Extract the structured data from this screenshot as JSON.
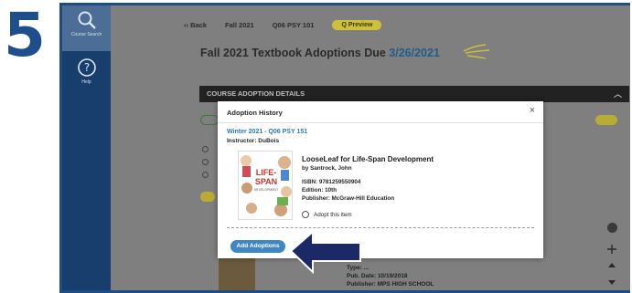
{
  "step": {
    "number": "5"
  },
  "sidebar": {
    "items": [
      {
        "label": "Course Search",
        "icon": "search-icon",
        "active": true
      },
      {
        "label": "Help",
        "icon": "help-icon",
        "active": false
      }
    ]
  },
  "topbar": {
    "back": "‹‹ Back",
    "term": "Fall 2021",
    "course": "Q06 PSY 101",
    "preview": "Q Preview"
  },
  "page": {
    "title": "Fall 2021 Textbook Adoptions Due",
    "due_date": "3/26/2021"
  },
  "section": {
    "label": "COURSE ADOPTION DETAILS",
    "toggle_icon": "chevron-up-icon"
  },
  "background": {
    "lower_type": "Type: ...",
    "pub_date": "Pub. Date: 10/19/2018",
    "publisher": "Publisher: MPS HIGH SCHOOL"
  },
  "modal": {
    "title": "Adoption History",
    "close": "×",
    "course_link": "Winter 2021 - Q06 PSY 151",
    "instructor": "Instructor: DuBois",
    "book": {
      "title": "LooseLeaf for Life-Span Development",
      "author": "by Santrock, John",
      "isbn": "ISBN: 9781259550904",
      "edition": "Edition: 10th",
      "publisher": "Publisher: McGraw-Hill Education",
      "cover_text_1": "LIFE-",
      "cover_text_2": "SPAN",
      "cover_text_3": "DEVELOPMENT"
    },
    "adopt_label": "Adopt this item",
    "add_button": "Add Adoptions"
  },
  "colors": {
    "brand_blue": "#1f4e8c",
    "sidebar": "#173e6d",
    "accent_button": "#3f86c3",
    "preview_pill": "#cfc03a"
  }
}
